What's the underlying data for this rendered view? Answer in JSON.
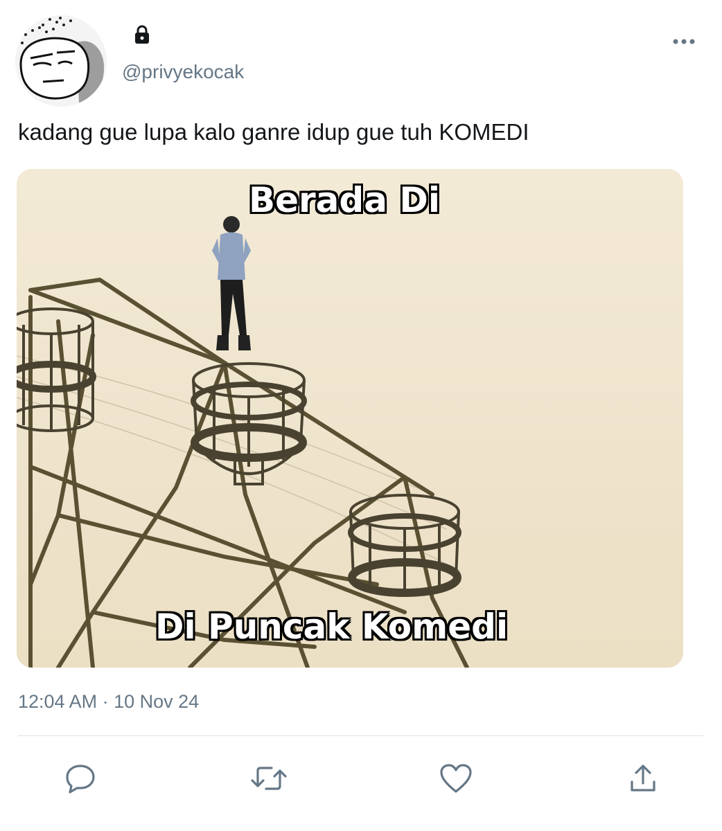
{
  "user": {
    "handle": "@privyekocak",
    "avatar_icon": "cartoon-face-avatar",
    "protected_icon": "lock-icon"
  },
  "tweet": {
    "text": "kadang gue lupa kalo ganre idup gue tuh KOMEDI",
    "timestamp": "12:04 AM · 10 Nov 24"
  },
  "media": {
    "caption_top": "Berada Di",
    "caption_bottom": "Di Puncak Komedi"
  },
  "actions": {
    "reply_icon": "reply-icon",
    "retweet_icon": "retweet-icon",
    "like_icon": "heart-icon",
    "share_icon": "share-icon",
    "more_icon": "more-icon"
  },
  "colors": {
    "text": "#14171a",
    "secondary": "#657786",
    "accent": "#1da1f2"
  }
}
